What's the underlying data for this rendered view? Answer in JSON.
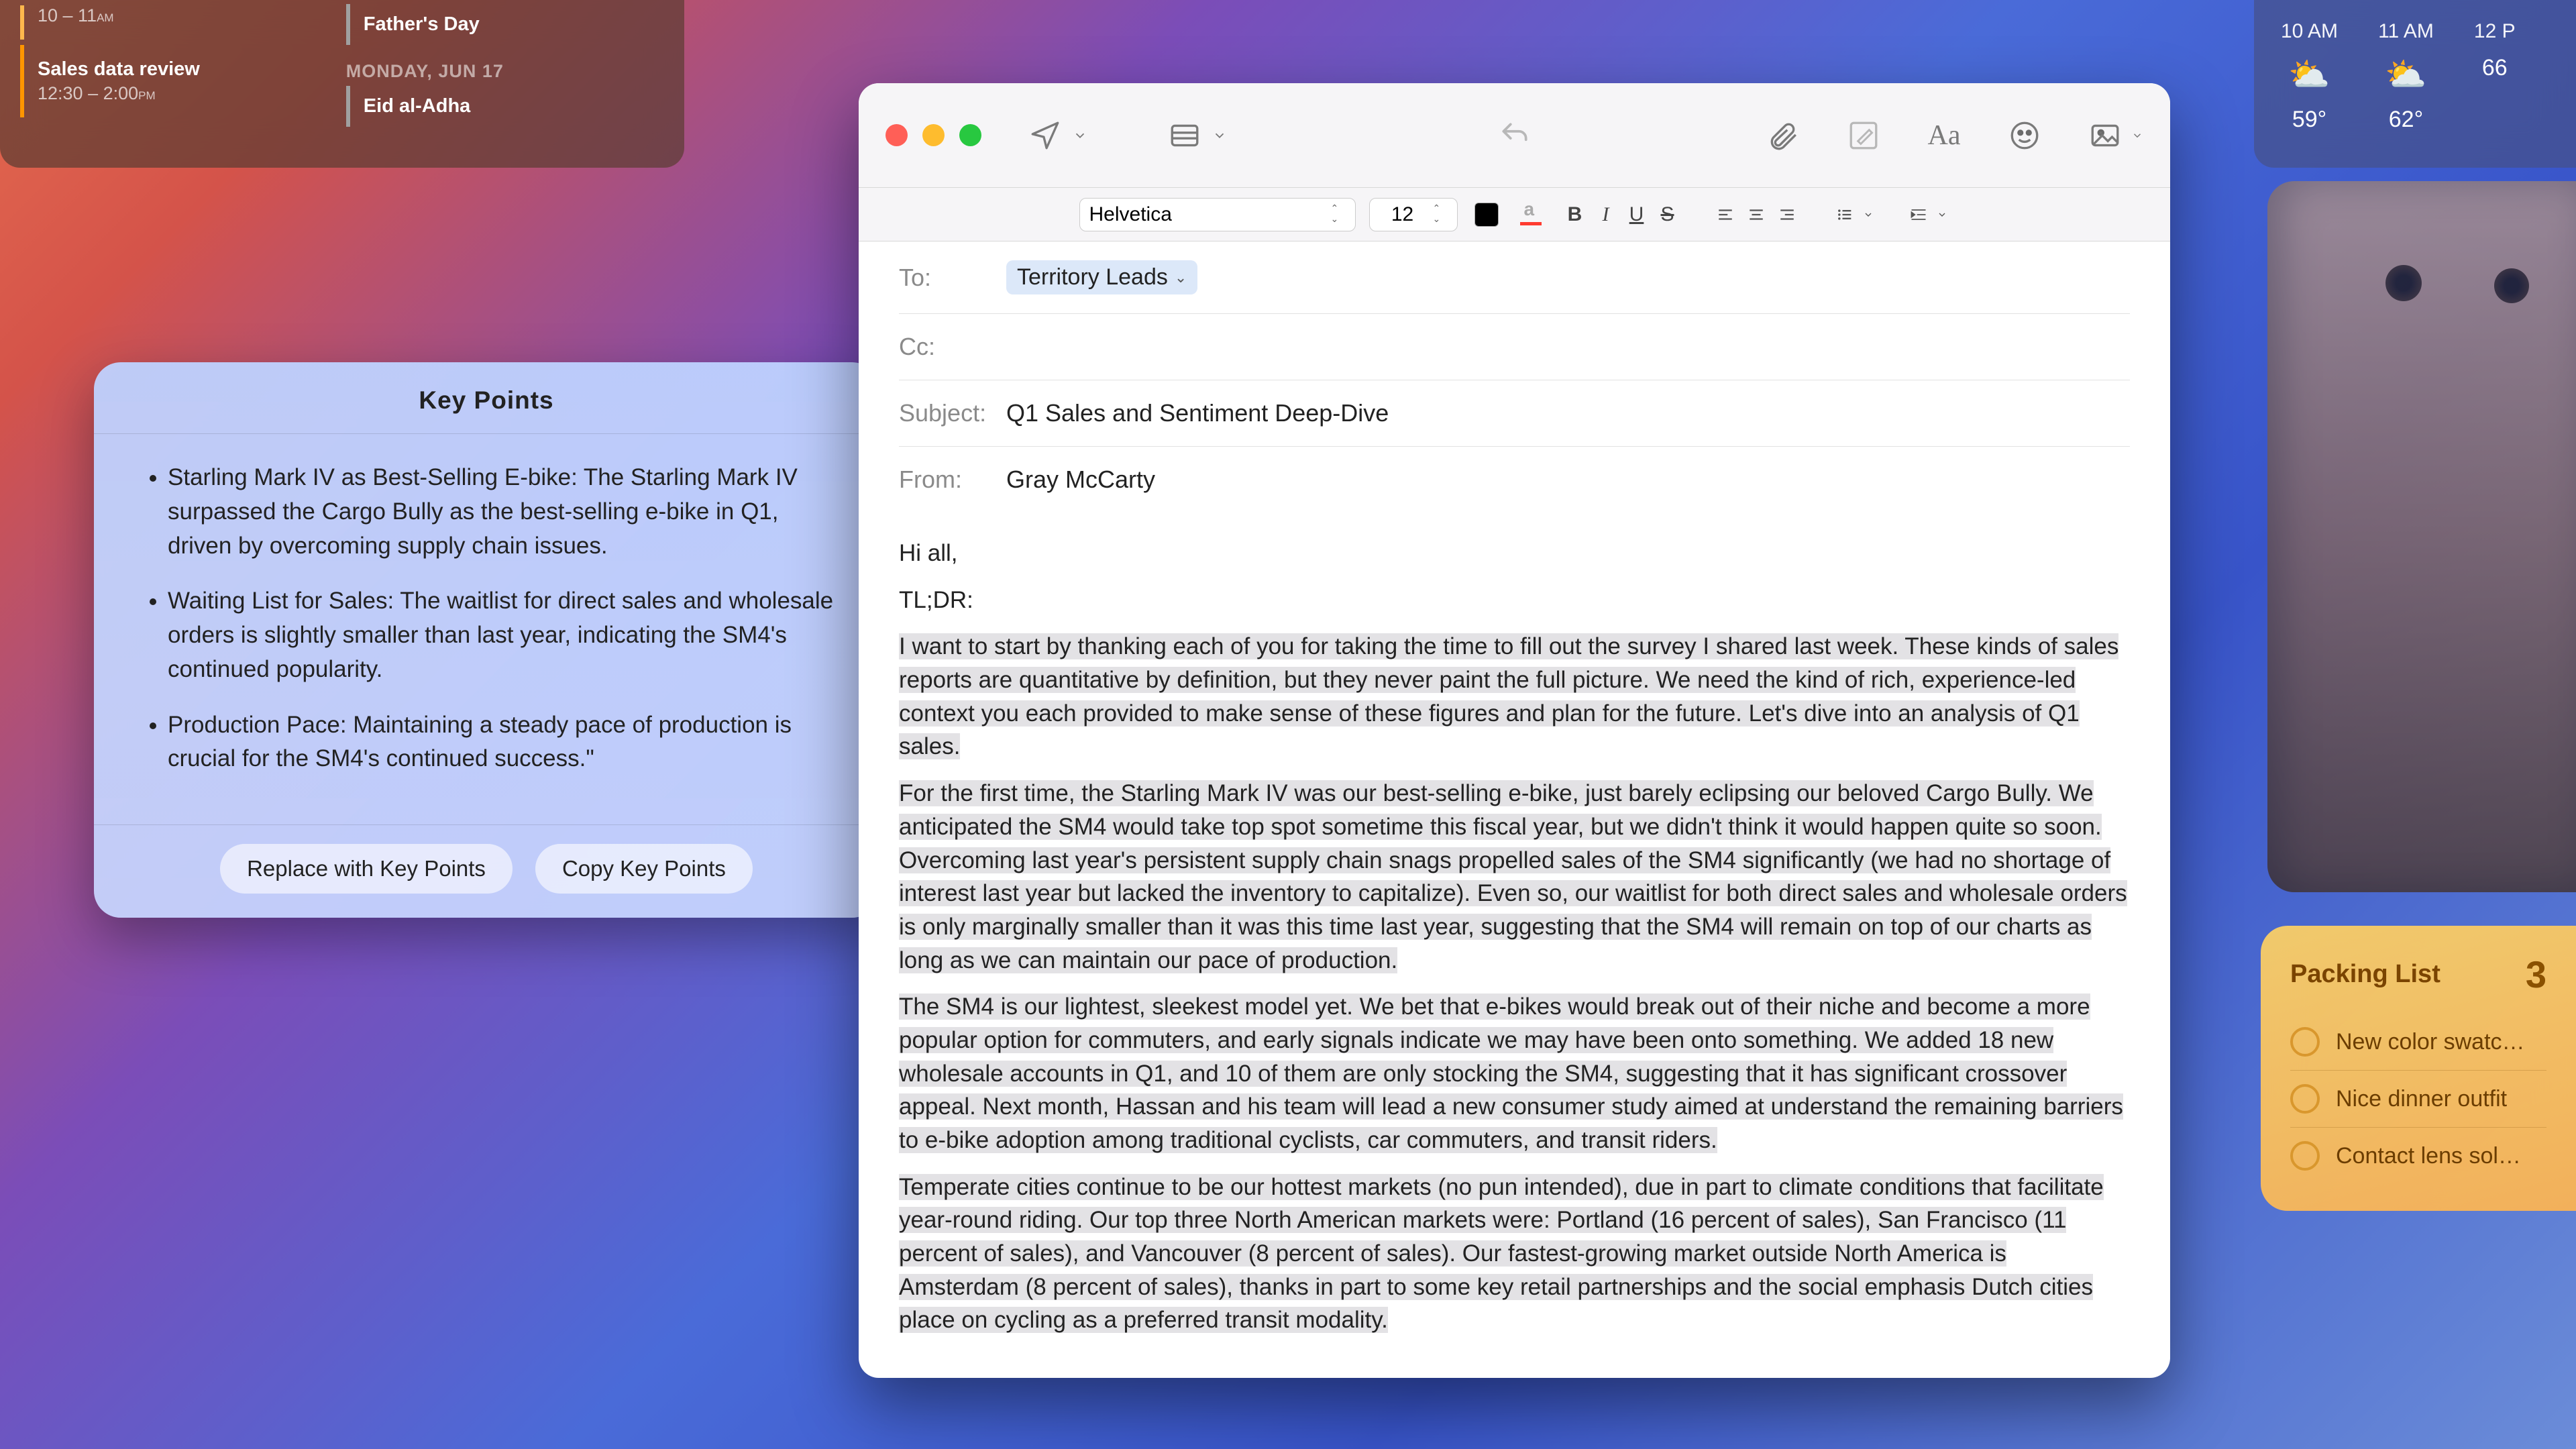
{
  "calendar": {
    "events": [
      {
        "title": "",
        "time_display": "10 – 11",
        "ampm_start": "",
        "ampm_end": "AM"
      },
      {
        "title": "Sales data review",
        "time_display": "12:30 – 2:00",
        "ampm_end": "PM"
      }
    ],
    "holidays_col": [
      {
        "label": "Father's Day"
      },
      {
        "date_label": "MONDAY, JUN 17"
      },
      {
        "label": "Eid al-Adha"
      }
    ]
  },
  "weather": {
    "hours": [
      {
        "time": "10 AM",
        "temp": "59°",
        "icon": "⛅"
      },
      {
        "time": "11 AM",
        "temp": "62°",
        "icon": "⛅"
      },
      {
        "time": "12 P",
        "temp": "66",
        "icon": ""
      }
    ]
  },
  "keypoints": {
    "title": "Key Points",
    "items": [
      "Starling Mark IV as Best-Selling E-bike: The Starling Mark IV surpassed the Cargo Bully as the best-selling e-bike in Q1, driven by overcoming supply chain issues.",
      "Waiting List for Sales: The waitlist for direct sales and wholesale orders is slightly smaller than last year, indicating the SM4's continued popularity.",
      "Production Pace: Maintaining a steady pace of production is crucial for the SM4's continued success.\""
    ],
    "replace_btn": "Replace with Key Points",
    "copy_btn": "Copy Key Points"
  },
  "mail": {
    "format": {
      "font": "Helvetica",
      "size": "12"
    },
    "to_label": "To:",
    "to_recipient": "Territory Leads",
    "cc_label": "Cc:",
    "subject_label": "Subject:",
    "subject_value": "Q1 Sales and Sentiment Deep-Dive",
    "from_label": "From:",
    "from_value": "Gray McCarty",
    "body": {
      "greeting": "Hi all,",
      "tldr_label": "TL;DR:",
      "p1": "I want to start by thanking each of you for taking the time to fill out the survey I shared last week. These kinds of sales reports are quantitative by definition, but they never paint the full picture. We need the kind of rich, experience-led context you each provided to make sense of these figures and plan for the future. Let's dive into an analysis of Q1 sales.",
      "p2": "For the first time, the Starling Mark IV was our best-selling e-bike, just barely eclipsing our beloved Cargo Bully. We anticipated the SM4 would take top spot sometime this fiscal year, but we didn't think it would happen quite so soon. Overcoming last year's persistent supply chain snags propelled sales of the SM4 significantly (we had no shortage of interest last year but lacked the inventory to capitalize). Even so, our waitlist for both direct sales and wholesale orders is only marginally smaller than it was this time last year, suggesting that the SM4 will remain on top of our charts as long as we can maintain our pace of production.",
      "p3": "The SM4 is our lightest, sleekest model yet. We bet that e-bikes would break out of their niche and become a more popular option for commuters, and early signals indicate we may have been onto something. We added 18 new wholesale accounts in Q1, and 10 of them are only stocking the SM4, suggesting that it has significant crossover appeal. Next month, Hassan and his team will lead a new consumer study aimed at understand the remaining barriers to e-bike adoption among traditional cyclists, car commuters, and transit riders.",
      "p4": "Temperate cities continue to be our hottest markets (no pun intended), due in part to climate conditions that facilitate year-round riding. Our top three North American markets were: Portland (16 percent of sales), San Francisco (11 percent of sales), and Vancouver (8 percent of sales). Our fastest-growing market outside North America is Amsterdam (8 percent of sales), thanks in part to some key retail partnerships and the social emphasis Dutch cities place on cycling as a preferred transit modality."
    }
  },
  "packing": {
    "title": "Packing List",
    "count": "3",
    "items": [
      "New color swatc…",
      "Nice dinner outfit",
      "Contact lens sol…"
    ]
  }
}
